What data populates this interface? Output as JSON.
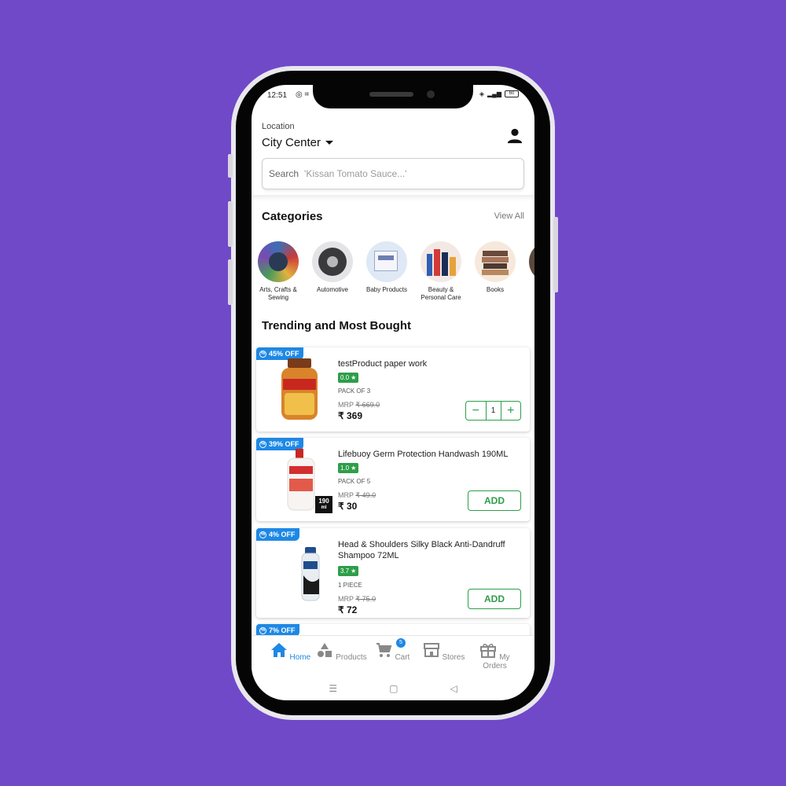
{
  "status_bar": {
    "time": "12:51",
    "battery": "60"
  },
  "header": {
    "location_label": "Location",
    "location_value": "City Center",
    "search_label": "Search",
    "search_placeholder": "'Kissan Tomato Sauce...'"
  },
  "categories": {
    "title": "Categories",
    "view_all": "View All",
    "items": [
      {
        "label": "Arts, Crafts & Sewing"
      },
      {
        "label": "Automotive"
      },
      {
        "label": "Baby Products"
      },
      {
        "label": "Beauty & Personal Care"
      },
      {
        "label": "Books"
      }
    ]
  },
  "trending": {
    "title": "Trending and Most Bought",
    "products": [
      {
        "discount": "45% OFF",
        "name": "testProduct paper work",
        "rating": "0.0",
        "pack": "PACK OF 3",
        "mrp_label": "MRP",
        "mrp": "₹ 669.0",
        "price": "₹ 369",
        "quantity": "1"
      },
      {
        "discount": "39% OFF",
        "name": "Lifebuoy Germ Protection Handwash 190ML",
        "rating": "1.0",
        "pack": "PACK OF 5",
        "mrp_label": "MRP",
        "mrp": "₹ 49.0",
        "price": "₹ 30",
        "add_label": "ADD",
        "size_tag": "190",
        "size_unit": "ml"
      },
      {
        "discount": "4% OFF",
        "name": "Head & Shoulders Silky Black Anti-Dandruff Shampoo 72ML",
        "rating": "3.7",
        "pack": "1  PIECE",
        "mrp_label": "MRP",
        "mrp": "₹ 75.0",
        "price": "₹ 72",
        "add_label": "ADD"
      },
      {
        "discount": "7% OFF"
      }
    ]
  },
  "bottom_nav": {
    "items": [
      {
        "label": "Home",
        "icon": "home-icon"
      },
      {
        "label": "Products",
        "icon": "shapes-icon"
      },
      {
        "label": "Cart",
        "icon": "cart-icon",
        "badge": "5"
      },
      {
        "label": "Stores",
        "icon": "store-icon"
      },
      {
        "label": "My Orders",
        "icon": "gift-box-icon"
      }
    ]
  },
  "colors": {
    "background": "#7049c9",
    "accent": "#1e88e5",
    "green": "#2e9e49"
  }
}
